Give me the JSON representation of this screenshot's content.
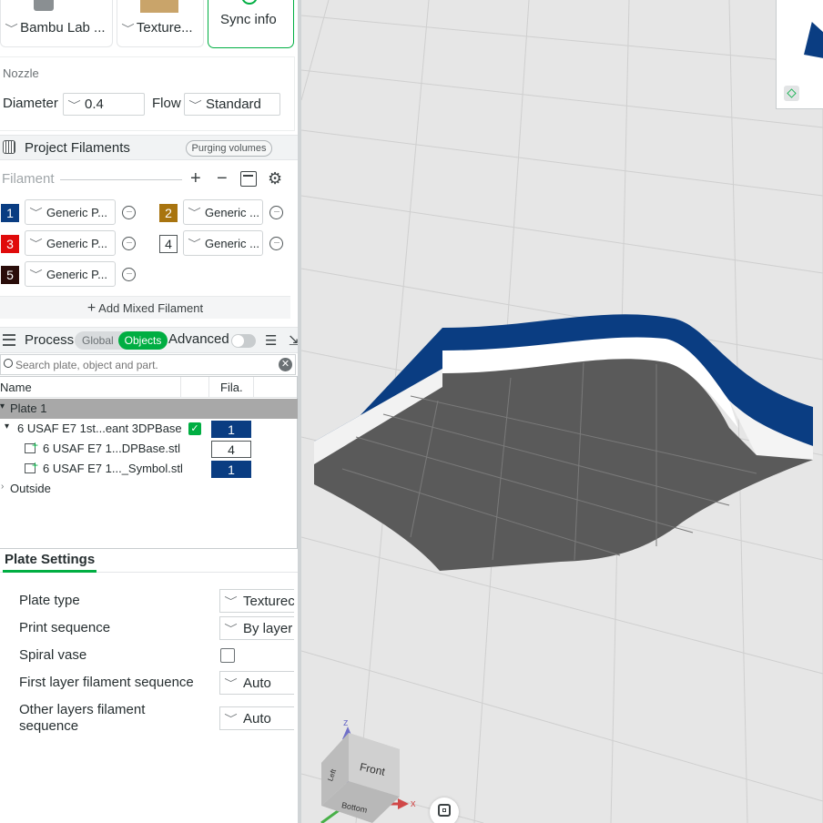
{
  "printer": {
    "printer_label": "Bambu Lab ...",
    "plate_label": "Texture...",
    "sync_label": "Sync info"
  },
  "nozzle": {
    "section": "Nozzle",
    "diameter_label": "Diameter",
    "diameter_value": "0.4",
    "flow_label": "Flow",
    "flow_value": "Standard"
  },
  "filaments": {
    "title": "Project Filaments",
    "purge_button": "Purging volumes",
    "filament_label": "Filament",
    "items": [
      {
        "num": "1",
        "name": "Generic P...",
        "color": "#0a3d82"
      },
      {
        "num": "2",
        "name": "Generic ...",
        "color": "#a8740f"
      },
      {
        "num": "3",
        "name": "Generic P...",
        "color": "#e00b0b"
      },
      {
        "num": "4",
        "name": "Generic ...",
        "color": "#ffffff"
      },
      {
        "num": "5",
        "name": "Generic P...",
        "color": "#2a0d0a"
      }
    ],
    "add_mixed": "Add Mixed Filament"
  },
  "process": {
    "title": "Process",
    "global_label": "Global",
    "objects_label": "Objects",
    "advanced_label": "Advanced",
    "search_placeholder": "Search plate, object and part."
  },
  "tree": {
    "col_name": "Name",
    "col_fila": "Fila.",
    "plate": "Plate 1",
    "object": {
      "name": "6 USAF E7 1st...eant 3DPBase",
      "fila": "1"
    },
    "parts": [
      {
        "name": "6 USAF E7 1...DPBase.stl",
        "fila": "4"
      },
      {
        "name": "6 USAF E7 1..._Symbol.stl",
        "fila": "1"
      }
    ],
    "outside": "Outside"
  },
  "plate_settings": {
    "tab": "Plate Settings",
    "rows": [
      {
        "label": "Plate type",
        "value": "Texturec"
      },
      {
        "label": "Print sequence",
        "value": "By layer"
      },
      {
        "label": "Spiral vase",
        "value": ""
      },
      {
        "label": "First layer filament sequence",
        "value": "Auto"
      },
      {
        "label": "Other layers filament sequence",
        "value": "Auto"
      }
    ]
  },
  "viewcube": {
    "front": "Front",
    "left": "Left",
    "bottom": "Bottom",
    "axis_x": "x",
    "axis_z": "z"
  },
  "colors": {
    "accent_green": "#00ae42",
    "model_blue": "#0a3d82",
    "bed_grey": "#5a5a5a"
  }
}
